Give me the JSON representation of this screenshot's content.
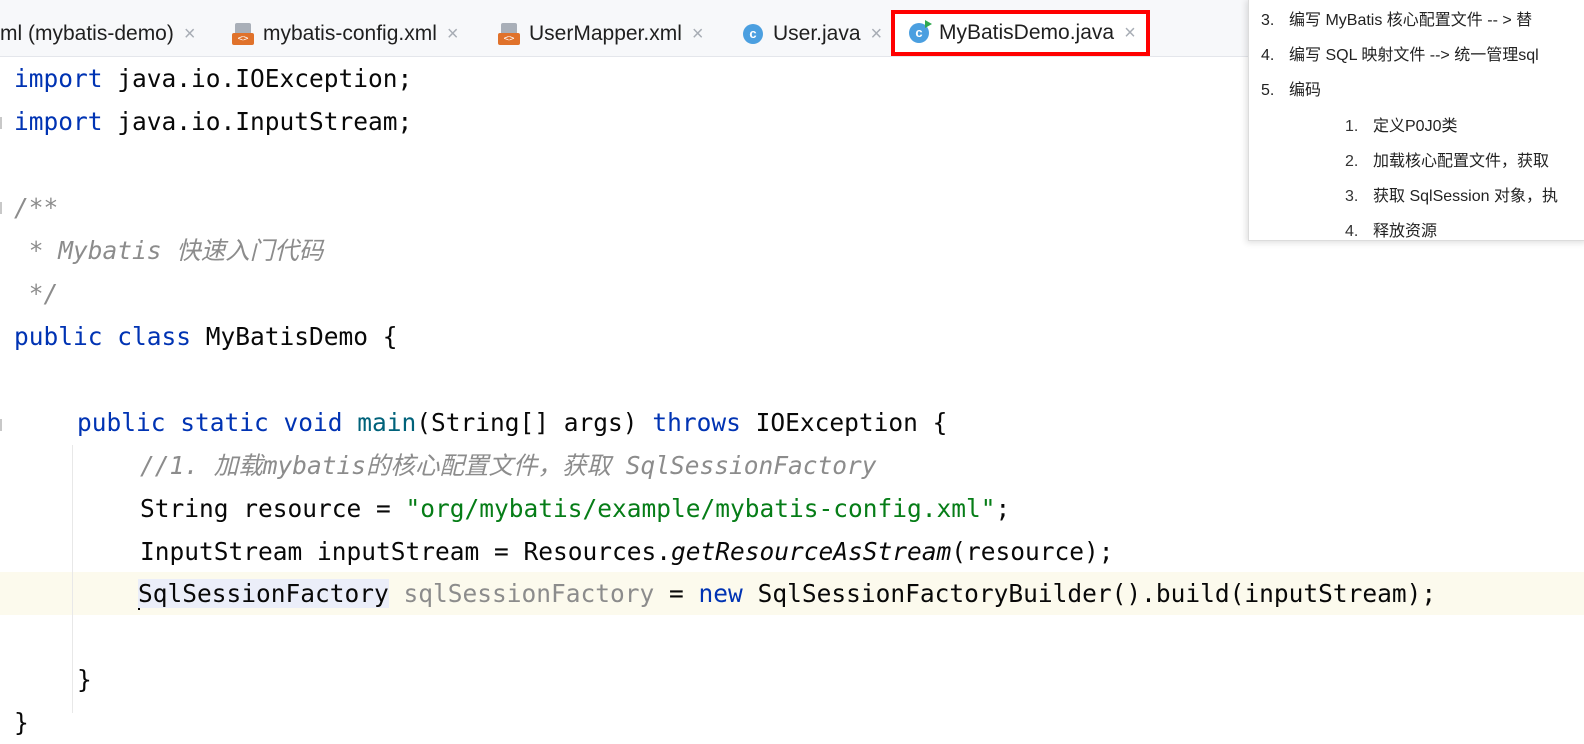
{
  "tabs": [
    {
      "label": "ml (mybatis-demo)",
      "icon": "none",
      "close": "×"
    },
    {
      "label": "mybatis-config.xml",
      "icon": "xml-file-icon",
      "close": "×"
    },
    {
      "label": "UserMapper.xml",
      "icon": "xml-file-icon",
      "close": "×"
    },
    {
      "label": "User.java",
      "icon": "class-icon",
      "close": "×"
    },
    {
      "label": "MyBatisDemo.java",
      "icon": "main-class-icon",
      "close": "×",
      "active": true,
      "highlighted": true
    }
  ],
  "code": {
    "l1_kw": "import",
    "l1_rest": " java.io.IOException;",
    "l2_kw": "import",
    "l2_rest": " java.io.InputStream;",
    "l4": "/**",
    "l5": " * Mybatis 快速入门代码",
    "l6": " */",
    "l7_kw": "public class",
    "l7_rest": " MyBatisDemo {",
    "l9_kw1": "public static void",
    "l9_fn": "main",
    "l9_mid": "(String[] args) ",
    "l9_kw2": "throws",
    "l9_end": " IOException {",
    "l10": "//1. 加载mybatis的核心配置文件，获取 SqlSessionFactory",
    "l11_a": "String resource = ",
    "l11_str": "\"org/mybatis/example/mybatis-config.xml\"",
    "l11_end": ";",
    "l12_a": "InputStream inputStream = Resources.",
    "l12_it": "getResourceAsStream",
    "l12_end": "(resource);",
    "l13_type": "SqlSessionFactory",
    "l13_unused": " sqlSessionFactory",
    "l13_mid": " = ",
    "l13_kw": "new",
    "l13_end": " SqlSessionFactoryBuilder().build(inputStream);",
    "l15": "}",
    "l16": "}"
  },
  "notes": [
    {
      "num": "3.",
      "text": "编写 MyBatis 核心配置文件  -- > 替"
    },
    {
      "num": "4.",
      "text": "编写 SQL 映射文件 --> 统一管理sql"
    },
    {
      "num": "5.",
      "text": "编码"
    },
    {
      "num": "1.",
      "text": "定义P0J0类"
    },
    {
      "num": "2.",
      "text": "加载核心配置文件，获取"
    },
    {
      "num": "3.",
      "text": "获取 SqlSession 对象，执"
    },
    {
      "num": "4.",
      "text": "释放资源"
    }
  ],
  "colors": {
    "keyword": "#0033b3",
    "string": "#067d17",
    "comment": "#8c8c8c",
    "highlight_box": "#ff0000"
  }
}
